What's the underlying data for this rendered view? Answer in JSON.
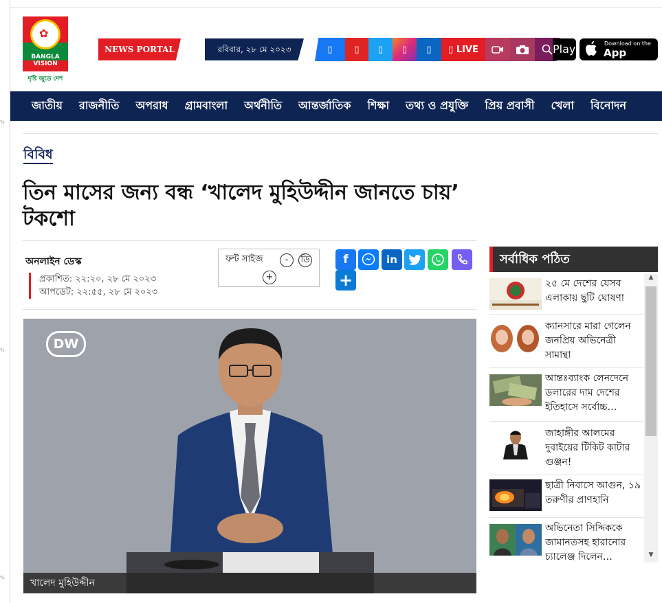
{
  "ruler": [
    "%",
    "%",
    "%"
  ],
  "logo": {
    "name_line1": "BANGLA",
    "name_line2": "VISION",
    "tagline": "দৃষ্টি জুড়ে দেশ"
  },
  "header": {
    "news_portal": "NEWS PORTAL",
    "date": "রবিবার, ২৮ মে ২০২৩",
    "live_label": "LIVE",
    "google_play": "Play",
    "appstore_small": "Download on the",
    "appstore_large": "App Store"
  },
  "nav": [
    "জাতীয়",
    "রাজনীতি",
    "অপরাধ",
    "গ্রামবাংলা",
    "অর্থনীতি",
    "আন্তর্জাতিক",
    "শিক্ষা",
    "তথ্য ও প্রযুক্তি",
    "প্রিয় প্রবাসী",
    "খেলা",
    "বিনোদন"
  ],
  "article": {
    "category": "বিবিধ",
    "headline": "তিন মাসের জন্য বন্ধ ‘খালেদ মুহিউদ্দীন জানতে চায়’ টকশো",
    "author": "অনলাইন ডেস্ক",
    "published": "প্রকাশিত: ২২:২০, ২৮ মে ২০২৩",
    "updated": "আপডেট: ২২:৫৫, ২৮ মে ২০২৩",
    "font_size_label": "ফন্ট সাইজ",
    "font_minus": "-",
    "font_default": "ডি",
    "font_plus": "+",
    "photo_logo": "DW",
    "photo_caption": "খালেদ মুহিউদ্দীন"
  },
  "sidebar": {
    "title": "সর্বাধিক পঠিত",
    "items": [
      {
        "title": "২৫ মে দেশের যেসব এলাকায় ছুটি ঘোষণা"
      },
      {
        "title": "ক্যানসারে মারা গেলেন জনপ্রিয় অভিনেত্রী সামান্থা"
      },
      {
        "title": "আন্তঃব্যাংক লেনদেনে ডলারের দাম দেশের ইতিহাসে সর্বোচ্চ…"
      },
      {
        "title": "জাহাঙ্গীর আলমের দুবাইয়ের টিকিট কাটার গুঞ্জন!"
      },
      {
        "title": "ছাত্রী নিবাসে আগুন, ১৯ তরুণীর প্রাণহানি"
      },
      {
        "title": "অভিনেতা সিদ্দিককে জামানতসহ হারানোর চ্যালেঞ্জ দিলেন…"
      }
    ]
  },
  "colors": {
    "brand_red": "#e31d24",
    "navy": "#0e2554",
    "sidebar_head": "#313131"
  }
}
